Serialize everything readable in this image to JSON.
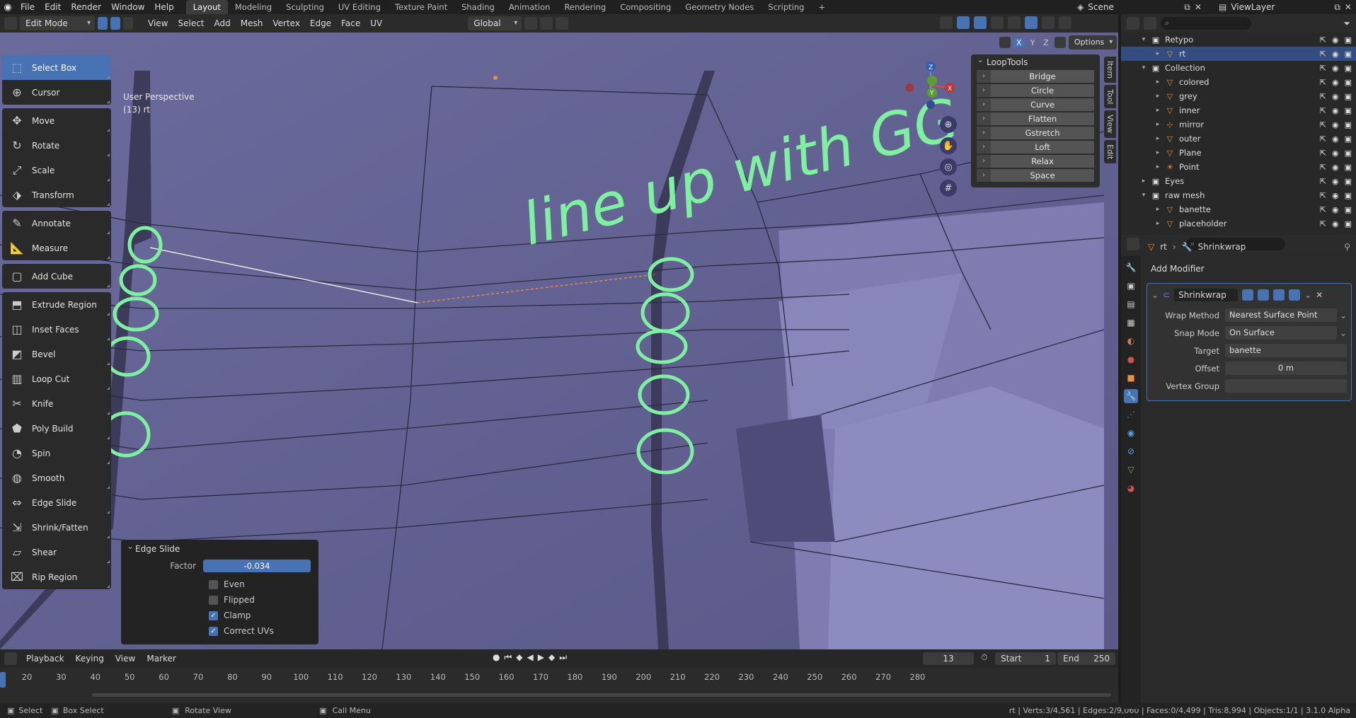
{
  "topbar": {
    "menus": [
      "File",
      "Edit",
      "Render",
      "Window",
      "Help"
    ],
    "workspaces": [
      "Layout",
      "Modeling",
      "Sculpting",
      "UV Editing",
      "Texture Paint",
      "Shading",
      "Animation",
      "Rendering",
      "Compositing",
      "Geometry Nodes",
      "Scripting"
    ],
    "active_workspace": "Layout",
    "scene": "Scene",
    "view_layer": "ViewLayer"
  },
  "viewport_header": {
    "mode": "Edit Mode",
    "menus": [
      "View",
      "Select",
      "Add",
      "Mesh",
      "Vertex",
      "Edge",
      "Face",
      "UV"
    ],
    "orientation": "Global",
    "axes": [
      "X",
      "Y",
      "Z"
    ],
    "options_label": "Options"
  },
  "viewport": {
    "perspective": "User Perspective",
    "object": "(13) rt",
    "annotation_text": "line up with GG",
    "gizmo_axes": [
      "Z",
      "Y",
      "X"
    ]
  },
  "toolbar": {
    "groups": [
      [
        "Select Box",
        "Cursor"
      ],
      [
        "Move",
        "Rotate",
        "Scale",
        "Transform"
      ],
      [
        "Annotate",
        "Measure"
      ],
      [
        "Add Cube"
      ],
      [
        "Extrude Region",
        "Inset Faces",
        "Bevel",
        "Loop Cut",
        "Knife",
        "Poly Build",
        "Spin",
        "Smooth",
        "Edge Slide",
        "Shrink/Fatten",
        "Shear",
        "Rip Region"
      ]
    ],
    "active": "Select Box"
  },
  "looptools": {
    "title": "LoopTools",
    "items": [
      "Bridge",
      "Circle",
      "Curve",
      "Flatten",
      "Gstretch",
      "Loft",
      "Relax",
      "Space"
    ]
  },
  "sidebar_tabs": [
    "Item",
    "Tool",
    "View",
    "Edit"
  ],
  "edge_slide": {
    "title": "Edge Slide",
    "factor_label": "Factor",
    "factor_value": "-0.034",
    "options": [
      {
        "label": "Even",
        "checked": false
      },
      {
        "label": "Flipped",
        "checked": false
      },
      {
        "label": "Clamp",
        "checked": true
      },
      {
        "label": "Correct UVs",
        "checked": true
      }
    ]
  },
  "timeline": {
    "menus": [
      "Playback",
      "Keying",
      "View",
      "Marker"
    ],
    "current_frame": "13",
    "start_label": "Start",
    "start": "1",
    "end_label": "End",
    "end": "250",
    "ticks": [
      "20",
      "30",
      "40",
      "50",
      "60",
      "70",
      "80",
      "90",
      "100",
      "110",
      "120",
      "130",
      "140",
      "150",
      "160",
      "170",
      "180",
      "190",
      "200",
      "210",
      "220",
      "230",
      "240",
      "250",
      "260",
      "270",
      "280"
    ]
  },
  "statusbar": {
    "select": "Select",
    "box_select": "Box Select",
    "rotate_view": "Rotate View",
    "call_menu": "Call Menu",
    "stats": "rt | Verts:3/4,561 | Edges:2/9,060 | Faces:0/4,499 | Tris:8,994 | Objects:1/1 | 3.1.0 Alpha"
  },
  "outliner": {
    "rows": [
      {
        "name": "Retypo",
        "level": 0,
        "type": "collection",
        "expanded": true
      },
      {
        "name": "rt",
        "level": 1,
        "type": "mesh",
        "selected": true
      },
      {
        "name": "Collection",
        "level": 0,
        "type": "collection",
        "expanded": true
      },
      {
        "name": "colored",
        "level": 1,
        "type": "mesh"
      },
      {
        "name": "grey",
        "level": 1,
        "type": "mesh"
      },
      {
        "name": "inner",
        "level": 1,
        "type": "mesh"
      },
      {
        "name": "mirror",
        "level": 1,
        "type": "empty"
      },
      {
        "name": "outer",
        "level": 1,
        "type": "mesh"
      },
      {
        "name": "Plane",
        "level": 1,
        "type": "mesh"
      },
      {
        "name": "Point",
        "level": 1,
        "type": "light"
      },
      {
        "name": "Eyes",
        "level": 0,
        "type": "collection"
      },
      {
        "name": "raw mesh",
        "level": 0,
        "type": "collection",
        "expanded": true
      },
      {
        "name": "banette",
        "level": 1,
        "type": "mesh"
      },
      {
        "name": "placeholder",
        "level": 1,
        "type": "mesh"
      }
    ]
  },
  "properties": {
    "breadcrumb_object": "rt",
    "breadcrumb_modifier": "Shrinkwrap",
    "add_modifier": "Add Modifier",
    "modifier_name": "Shrinkwrap",
    "fields": [
      {
        "label": "Wrap Method",
        "value": "Nearest Surface Point",
        "kind": "dropdown"
      },
      {
        "label": "Snap Mode",
        "value": "On Surface",
        "kind": "dropdown"
      },
      {
        "label": "Target",
        "value": "banette",
        "kind": "object"
      },
      {
        "label": "Offset",
        "value": "0 m",
        "kind": "number"
      },
      {
        "label": "Vertex Group",
        "value": "",
        "kind": "vgroup"
      }
    ]
  },
  "colors": {
    "accent": "#4772b3",
    "viewport": "#5e5d8f",
    "annotation": "#7ef0a0",
    "panel": "#2a2a2a"
  }
}
